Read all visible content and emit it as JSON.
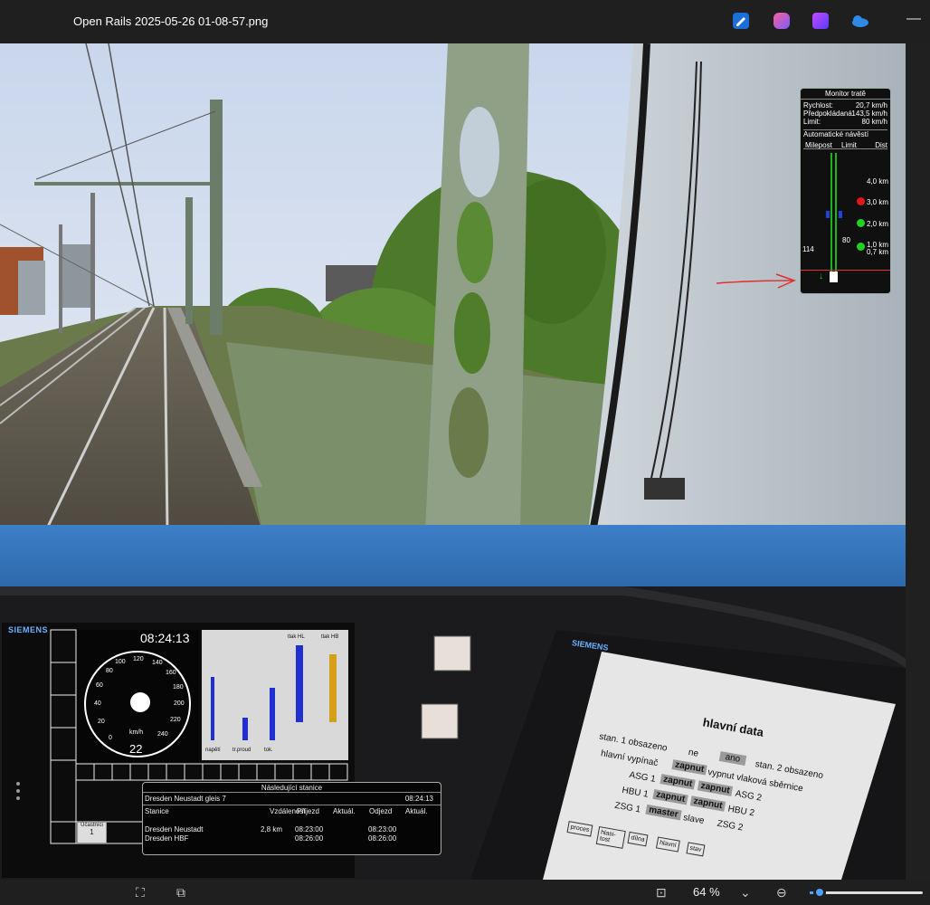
{
  "window": {
    "title": "Open Rails 2025-05-26 01-08-57.png"
  },
  "toolbar_icons": [
    {
      "name": "edit-icon",
      "color": "#3a8df0"
    },
    {
      "name": "copilot-icon",
      "color": "#b86bff"
    },
    {
      "name": "clipchamp-icon",
      "color": "#7a4cff"
    },
    {
      "name": "onedrive-icon",
      "color": "#2f8ae5"
    }
  ],
  "track_monitor": {
    "title": "Monitor tratě",
    "speed_label": "Rychlost:",
    "speed_value": "20,7 km/h",
    "projected_label": "Předpokládaná",
    "projected_value": "143,5 km/h",
    "limit_label": "Limit:",
    "limit_value": "80 km/h",
    "mode": "Automatické návěstí",
    "col_milepost": "Milepost",
    "col_limit": "Limit",
    "col_dist": "Dist",
    "rows": [
      {
        "dist": "4,0 km",
        "signal": ""
      },
      {
        "dist": "3,0 km",
        "signal": "red"
      },
      {
        "dist": "2,0 km",
        "signal": "green"
      },
      {
        "dist": "1,0 km",
        "signal": "green"
      },
      {
        "dist": "0,7 km",
        "signal": ""
      }
    ],
    "milepost": "114",
    "limit_mark": "80"
  },
  "speedometer": {
    "brand": "SIEMENS",
    "clock": "08:24:13",
    "unit": "km/h",
    "speed": "22",
    "ticks": [
      "0",
      "20",
      "40",
      "60",
      "80",
      "100",
      "120",
      "140",
      "160",
      "180",
      "200",
      "220",
      "240"
    ]
  },
  "gauges": {
    "labels": [
      "napětí",
      "tr.proud",
      "tok."
    ],
    "right_labels": [
      "tlak HL",
      "tlak HB"
    ],
    "levels": [
      0.6,
      0.22,
      0.48,
      0.9,
      0.85
    ]
  },
  "next_station": {
    "title": "Následující stanice",
    "current": "Dresden Neustadt gleis 7",
    "time": "08:24:13",
    "headers": [
      "Stanice",
      "Vzdálenost",
      "Příjezd",
      "Aktuál.",
      "Odjezd",
      "Aktuál."
    ],
    "rows": [
      {
        "station": "Dresden Neustadt",
        "distance": "2,8 km",
        "arrival": "08:23:00",
        "departure": "08:23:00"
      },
      {
        "station": "Dresden HBF",
        "distance": "",
        "arrival": "08:26:00",
        "departure": "08:26:00"
      }
    ],
    "ucastnici_label": "Účastníci",
    "ucastnici_value": "1"
  },
  "cab_screen": {
    "brand": "SIEMENS",
    "heading": "hlavní data",
    "line1": {
      "left": "stan. 1 obsazeno",
      "mid": "ne",
      "box": "ano",
      "right": "stan. 2 obsazeno"
    },
    "line2": {
      "left": "hlavní vypínač",
      "box": "zapnut",
      "right": "vypnut vlaková sběrnice"
    },
    "line3": {
      "left": "ASG 1",
      "box1": "zapnut",
      "box2": "zapnut",
      "right": "ASG 2"
    },
    "line4": {
      "left": "HBU 1",
      "box1": "zapnut",
      "box2": "zapnut",
      "right": "HBU 2"
    },
    "line5": {
      "left": "ZSG 1",
      "box": "master",
      "mid": "slave",
      "right": "ZSG 2"
    },
    "tabs": [
      "proces",
      "hlasi-tost",
      "dílna",
      "hlavní",
      "stav"
    ]
  },
  "bottom_bar": {
    "zoom": "64 %"
  }
}
